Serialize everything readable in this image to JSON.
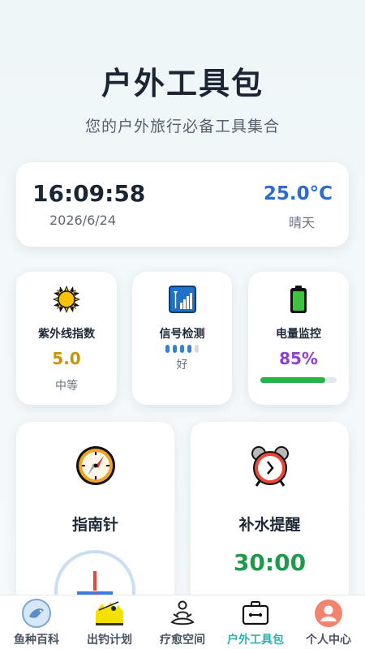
{
  "header": {
    "title": "户外工具包",
    "subtitle": "您的户外旅行必备工具集合"
  },
  "status": {
    "time": "16:09:58",
    "date": "2026/6/24",
    "temperature": "25.0°C",
    "weather": "晴天"
  },
  "tools": {
    "uv": {
      "label": "紫外线指数",
      "value": "5.0",
      "level": "中等",
      "icon": "sun-icon"
    },
    "signal": {
      "label": "信号检测",
      "quality": "好",
      "bars_on": 4,
      "bars_total": 5,
      "icon": "signal-icon"
    },
    "battery": {
      "label": "电量监控",
      "value": "85%",
      "level_percent": 85,
      "icon": "battery-icon"
    }
  },
  "big_tools": {
    "compass": {
      "label": "指南针",
      "icon": "compass-icon"
    },
    "water": {
      "label": "补水提醒",
      "timer": "30:00",
      "icon": "alarm-clock-icon"
    }
  },
  "tabbar": {
    "items": [
      {
        "label": "鱼种百科",
        "icon": "fish-icon"
      },
      {
        "label": "出钓计划",
        "icon": "fishing-plan-icon"
      },
      {
        "label": "疗愈空间",
        "icon": "meditation-icon"
      },
      {
        "label": "户外工具包",
        "icon": "toolbox-icon",
        "active": true
      },
      {
        "label": "个人中心",
        "icon": "user-icon"
      }
    ]
  },
  "colors": {
    "accent": "#2bb3b0",
    "temperature": "#2b6bd4",
    "uv": "#c9930b",
    "battery_text": "#8e3fd6",
    "battery_bar": "#27b24a",
    "timer": "#1f9a4b"
  }
}
